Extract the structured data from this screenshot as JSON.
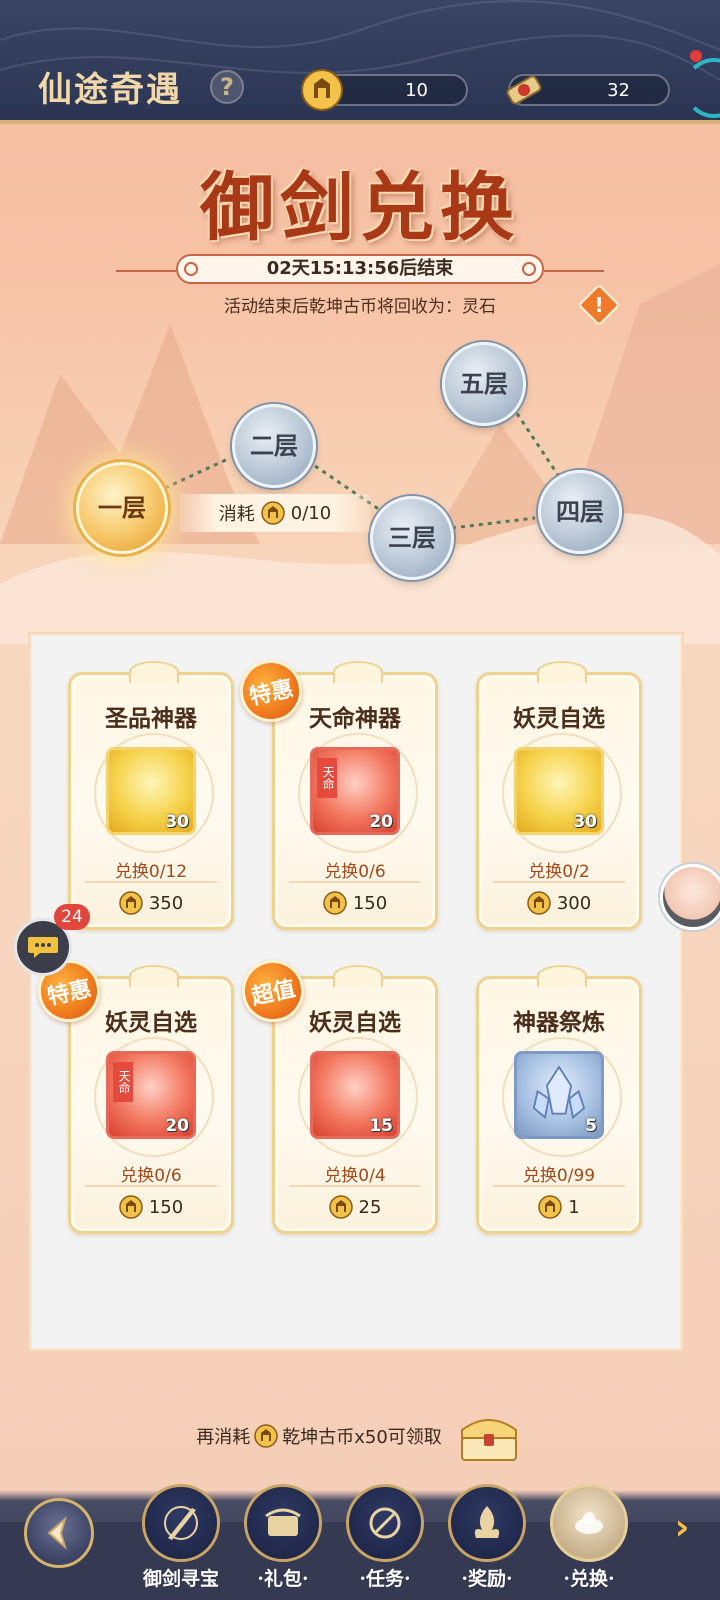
{
  "header": {
    "title": "仙途奇遇",
    "help_icon": "question-icon",
    "currencies": [
      {
        "icon": "qiankun-coin-icon",
        "value": "10"
      },
      {
        "icon": "scroll-token-icon",
        "value": "32"
      }
    ]
  },
  "banner": {
    "title": "御剑兑换",
    "timer": "02天15:13:56后结束",
    "notice": "活动结束后乾坤古币将回收为：灵石",
    "warning_icon": "warning-icon"
  },
  "levels": {
    "nodes": [
      "一层",
      "二层",
      "三层",
      "四层",
      "五层"
    ],
    "active": "一层",
    "cost_label": "消耗",
    "cost_value": "0/10"
  },
  "shop": {
    "items": [
      {
        "name": "圣品神器",
        "qty": "30",
        "style": "gold",
        "redeem": "兑换0/12",
        "price": "350",
        "badge": ""
      },
      {
        "name": "天命神器",
        "qty": "20",
        "style": "red",
        "redeem": "兑换0/6",
        "price": "150",
        "badge": "特惠"
      },
      {
        "name": "妖灵自选",
        "qty": "30",
        "style": "gold",
        "redeem": "兑换0/2",
        "price": "300",
        "badge": ""
      },
      {
        "name": "妖灵自选",
        "qty": "20",
        "style": "red",
        "redeem": "兑换0/6",
        "price": "150",
        "badge": "特惠"
      },
      {
        "name": "妖灵自选",
        "qty": "15",
        "style": "red",
        "redeem": "兑换0/4",
        "price": "25",
        "badge": "超值"
      },
      {
        "name": "神器祭炼",
        "qty": "5",
        "style": "blue",
        "redeem": "兑换0/99",
        "price": "1",
        "badge": ""
      }
    ],
    "ribbon_text": "天命"
  },
  "chat": {
    "count": "24"
  },
  "claim": {
    "prefix": "再消耗",
    "suffix": "乾坤古币x50可领取"
  },
  "nav": {
    "items": [
      {
        "label": "御剑寻宝",
        "icon": "sword-treasure-icon"
      },
      {
        "label": "·礼包·",
        "icon": "gift-icon"
      },
      {
        "label": "·任务·",
        "icon": "task-icon"
      },
      {
        "label": "·奖励·",
        "icon": "reward-icon"
      },
      {
        "label": "·兑换·",
        "icon": "exchange-icon"
      }
    ],
    "active_index": 4
  },
  "colors": {
    "topbar": "#2b3553",
    "accent_gold": "#f0d28f",
    "title_red": "#a93816",
    "badge_orange": "#f07a1d"
  }
}
